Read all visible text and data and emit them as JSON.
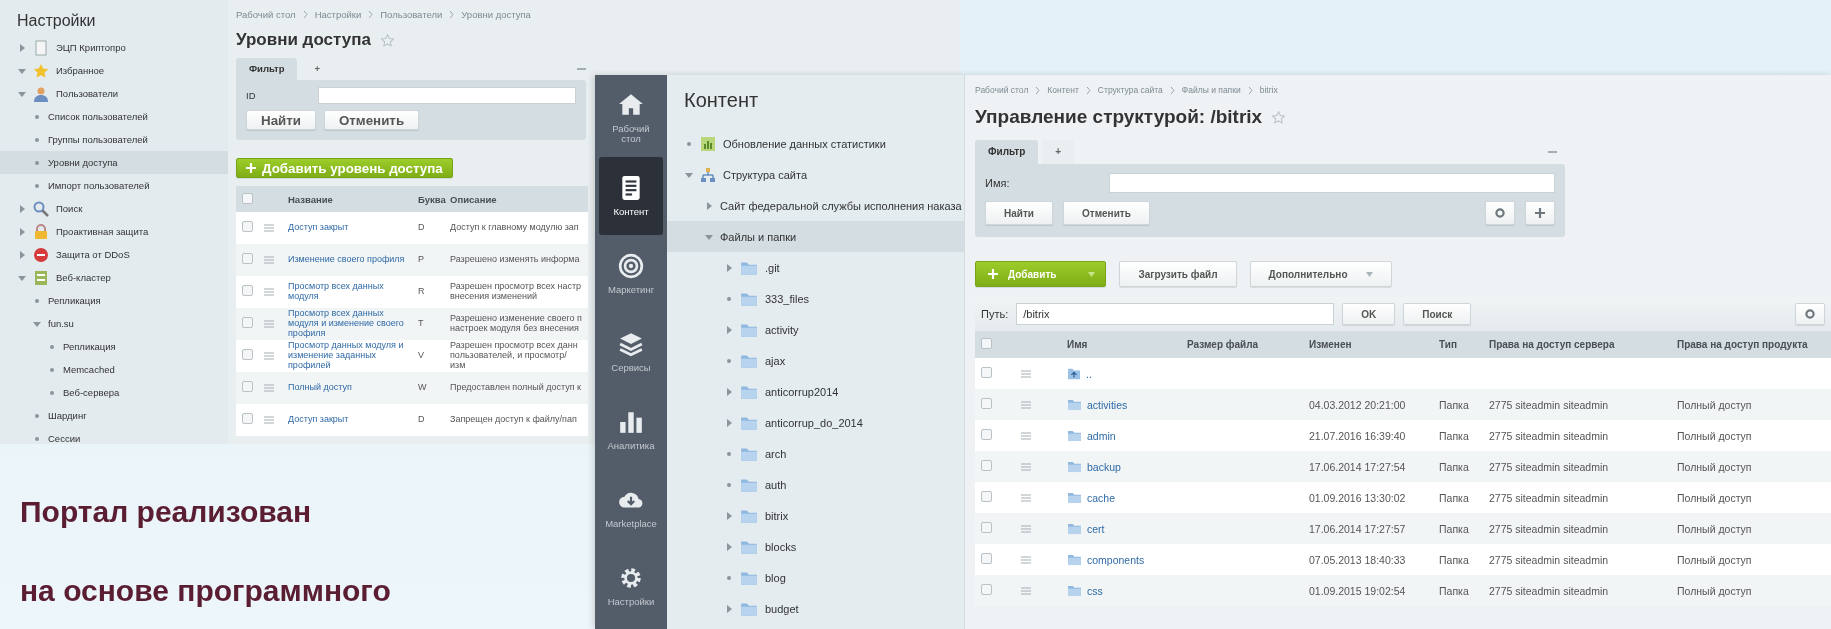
{
  "caption": "Портал реализован\nна основе программного",
  "settings_window": {
    "sidebar_title": "Настройки",
    "sidebar": [
      {
        "label": "ЭЦП Криптопро",
        "kind": "branch",
        "expanded": false,
        "selected": false
      },
      {
        "label": "Избранное",
        "kind": "branch",
        "expanded": true,
        "selected": false
      },
      {
        "label": "Пользователи",
        "kind": "branch",
        "expanded": true,
        "selected": false,
        "children": [
          {
            "label": "Список пользователей",
            "kind": "leaf",
            "selected": false
          },
          {
            "label": "Группы пользователей",
            "kind": "leaf",
            "selected": false
          },
          {
            "label": "Уровни доступа",
            "kind": "leaf",
            "selected": true
          },
          {
            "label": "Импорт пользователей",
            "kind": "leaf",
            "selected": false
          }
        ]
      },
      {
        "label": "Поиск",
        "kind": "branch",
        "expanded": false,
        "selected": false
      },
      {
        "label": "Проактивная защита",
        "kind": "branch",
        "expanded": false,
        "selected": false
      },
      {
        "label": "Защита от DDoS",
        "kind": "branch",
        "expanded": false,
        "selected": false
      },
      {
        "label": "Веб-кластер",
        "kind": "branch",
        "expanded": true,
        "selected": false,
        "children": [
          {
            "label": "Репликация",
            "kind": "leaf",
            "selected": false
          },
          {
            "label": "fun.su",
            "kind": "branch",
            "expanded": true,
            "selected": false,
            "children": [
              {
                "label": "Репликация",
                "kind": "leaf",
                "selected": false
              },
              {
                "label": "Memcached",
                "kind": "leaf",
                "selected": false
              },
              {
                "label": "Веб-сервера",
                "kind": "leaf",
                "selected": false
              }
            ]
          },
          {
            "label": "Шардинг",
            "kind": "leaf",
            "selected": false
          },
          {
            "label": "Сессии",
            "kind": "leaf",
            "selected": false
          }
        ]
      }
    ],
    "breadcrumb": [
      "Рабочий стол",
      "Настройки",
      "Пользователи",
      "Уровни доступа"
    ],
    "title": "Уровни доступа",
    "filter": {
      "tabs": [
        {
          "label": "Фильтр",
          "selected": true
        },
        {
          "label": "+",
          "selected": false
        }
      ],
      "field_label": "ID",
      "buttons": [
        "Найти",
        "Отменить"
      ]
    },
    "add_button": "Добавить уровень доступа",
    "table": {
      "header_checkbox": {
        "checked": false
      },
      "columns": [
        "Название",
        "Буква",
        "Описание"
      ],
      "rows": [
        {
          "checked": false,
          "name": "Доступ закрыт",
          "letter": "D",
          "description": "Доступ к главному модулю зап"
        },
        {
          "checked": false,
          "name": "Изменение своего профиля",
          "letter": "P",
          "description": "Разрешено изменять информа"
        },
        {
          "checked": false,
          "name": "Просмотр всех данных модуля",
          "letter": "R",
          "description": "Разрешен просмотр всех настр внесения изменений"
        },
        {
          "checked": false,
          "name": "Просмотр всех данных модуля и изменение своего профиля",
          "letter": "T",
          "description": "Разрешено изменение своего п настроек модуля без внесения"
        },
        {
          "checked": false,
          "name": "Просмотр данных модуля и изменение заданных профилей",
          "letter": "V",
          "description": "Разрешен просмотр всех данн пользователей, и просмотр/изм"
        },
        {
          "checked": false,
          "name": "Полный доступ",
          "letter": "W",
          "description": "Предоставлен полный доступ к"
        },
        {
          "checked": false,
          "name": "Доступ закрыт",
          "letter": "D",
          "description": "Запрещен доступ к файлу/пап"
        }
      ]
    }
  },
  "content_window": {
    "nav": [
      {
        "label": "Рабочий стол",
        "selected": false
      },
      {
        "label": "Контент",
        "selected": true
      },
      {
        "label": "Маркетинг",
        "selected": false
      },
      {
        "label": "Сервисы",
        "selected": false
      },
      {
        "label": "Аналитика",
        "selected": false
      },
      {
        "label": "Marketplace",
        "selected": false
      },
      {
        "label": "Настройки",
        "selected": false
      }
    ],
    "tree_title": "Контент",
    "tree": [
      {
        "label": "Обновление данных статистики",
        "kind": "leaf",
        "selected": false
      },
      {
        "label": "Структура сайта",
        "kind": "branch",
        "expanded": true,
        "selected": false,
        "children": [
          {
            "label": "Сайт федеральной службы исполнения наказа",
            "kind": "branch",
            "expanded": false,
            "selected": false
          },
          {
            "label": "Файлы и папки",
            "kind": "branch",
            "expanded": true,
            "selected": true,
            "children": [
              {
                "label": ".git",
                "kind": "branch",
                "expanded": false,
                "selected": false
              },
              {
                "label": "333_files",
                "kind": "leaf",
                "selected": false
              },
              {
                "label": "activity",
                "kind": "branch",
                "expanded": false,
                "selected": false
              },
              {
                "label": "ajax",
                "kind": "leaf",
                "selected": false
              },
              {
                "label": "anticorrup2014",
                "kind": "branch",
                "expanded": false,
                "selected": false
              },
              {
                "label": "anticorrup_do_2014",
                "kind": "branch",
                "expanded": false,
                "selected": false
              },
              {
                "label": "arch",
                "kind": "leaf",
                "selected": false
              },
              {
                "label": "auth",
                "kind": "leaf",
                "selected": false
              },
              {
                "label": "bitrix",
                "kind": "branch",
                "expanded": false,
                "selected": false
              },
              {
                "label": "blocks",
                "kind": "branch",
                "expanded": false,
                "selected": false
              },
              {
                "label": "blog",
                "kind": "leaf",
                "selected": false
              },
              {
                "label": "budget",
                "kind": "branch",
                "expanded": false,
                "selected": false
              }
            ]
          }
        ]
      }
    ],
    "breadcrumb": [
      "Рабочий стол",
      "Контент",
      "Структура сайта",
      "Файлы и папки",
      "bitrix"
    ],
    "title": "Управление структурой: /bitrix",
    "filter": {
      "tabs": [
        {
          "label": "Фильтр",
          "selected": true
        },
        {
          "label": "+",
          "selected": false
        }
      ],
      "field_label": "Имя:",
      "buttons": [
        "Найти",
        "Отменить"
      ]
    },
    "toolbar": {
      "add_button": "Добавить",
      "upload_button": "Загрузить файл",
      "more_button": "Дополнительно"
    },
    "path": {
      "label": "Путь:",
      "value": "/bitrix",
      "ok_button": "OK",
      "search_button": "Поиск"
    },
    "table": {
      "header_checkbox": {
        "checked": false
      },
      "columns": [
        "Имя",
        "Размер файла",
        "Изменен",
        "Тип",
        "Права на доступ сервера",
        "Права на доступ продукта"
      ],
      "rows": [
        {
          "kind": "up",
          "checked": false,
          "name": ".."
        },
        {
          "kind": "folder",
          "checked": false,
          "name": "activities",
          "modified": "04.03.2012 20:21:00",
          "type": "Папка",
          "server_rights": "2775 siteadmin siteadmin",
          "product_rights": "Полный доступ"
        },
        {
          "kind": "folder",
          "checked": false,
          "name": "admin",
          "modified": "21.07.2016 16:39:40",
          "type": "Папка",
          "server_rights": "2775 siteadmin siteadmin",
          "product_rights": "Полный доступ"
        },
        {
          "kind": "folder",
          "checked": false,
          "name": "backup",
          "modified": "17.06.2014 17:27:54",
          "type": "Папка",
          "server_rights": "2775 siteadmin siteadmin",
          "product_rights": "Полный доступ"
        },
        {
          "kind": "folder",
          "checked": false,
          "name": "cache",
          "modified": "01.09.2016 13:30:02",
          "type": "Папка",
          "server_rights": "2775 siteadmin siteadmin",
          "product_rights": "Полный доступ"
        },
        {
          "kind": "folder",
          "checked": false,
          "name": "cert",
          "modified": "17.06.2014 17:27:57",
          "type": "Папка",
          "server_rights": "2775 siteadmin siteadmin",
          "product_rights": "Полный доступ"
        },
        {
          "kind": "folder",
          "checked": false,
          "name": "components",
          "modified": "07.05.2013 18:40:33",
          "type": "Папка",
          "server_rights": "2775 siteadmin siteadmin",
          "product_rights": "Полный доступ"
        },
        {
          "kind": "folder",
          "checked": false,
          "name": "css",
          "modified": "01.09.2015 19:02:54",
          "type": "Папка",
          "server_rights": "2775 siteadmin siteadmin",
          "product_rights": "Полный доступ"
        }
      ]
    }
  }
}
